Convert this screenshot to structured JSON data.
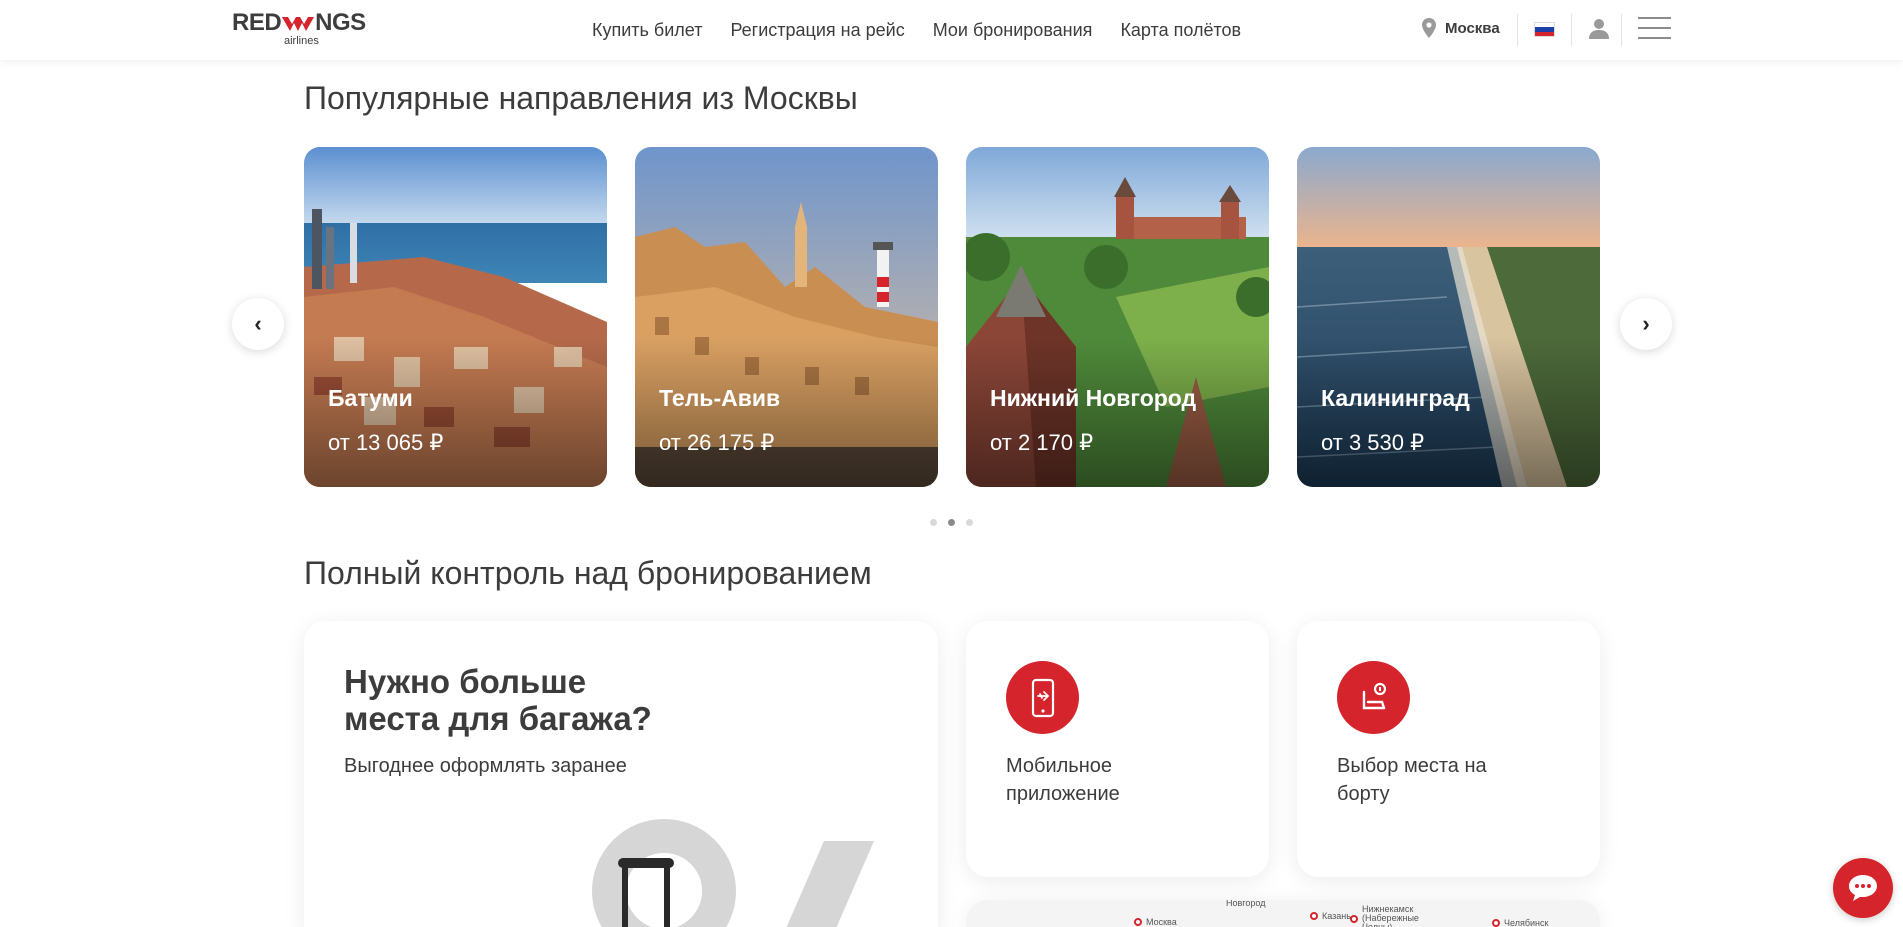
{
  "brand": {
    "logo_red": "RED",
    "logo_wings": "NGS",
    "logo_sub": "airlines",
    "accent": "#d5242c"
  },
  "nav": {
    "items": [
      "Купить билет",
      "Регистрация на рейс",
      "Мои бронирования",
      "Карта полётов"
    ]
  },
  "header": {
    "city": "Москва",
    "icons": [
      "location-pin-icon",
      "russia-flag-icon",
      "user-icon",
      "menu-icon"
    ]
  },
  "popular": {
    "title": "Популярные направления из Москвы",
    "cards": [
      {
        "city": "Батуми",
        "price": "от 13 065 ₽"
      },
      {
        "city": "Тель-Авив",
        "price": "от 26 175 ₽"
      },
      {
        "city": "Нижний Новгород",
        "price": "от 2 170 ₽"
      },
      {
        "city": "Калининград",
        "price": "от 3 530 ₽"
      }
    ],
    "prev_icon": "chevron-left-icon",
    "next_icon": "chevron-right-icon",
    "pages": 3,
    "active_page": 2
  },
  "control": {
    "title": "Полный контроль над бронированием",
    "baggage": {
      "heading_line1": "Нужно больше",
      "heading_line2": "места для багажа?",
      "subtitle": "Выгоднее оформлять заранее",
      "decor": "%"
    },
    "features": [
      {
        "label": "Мобильное приложение",
        "icon": "mobile-app-icon"
      },
      {
        "label": "Выбор места на борту",
        "icon": "seat-icon"
      }
    ]
  },
  "map": {
    "labels": [
      "Москва",
      "Новгород",
      "Казань",
      "Нижнекамск (Набережные Челны)",
      "Челябинск"
    ]
  },
  "chat": {
    "icon": "chat-icon"
  }
}
